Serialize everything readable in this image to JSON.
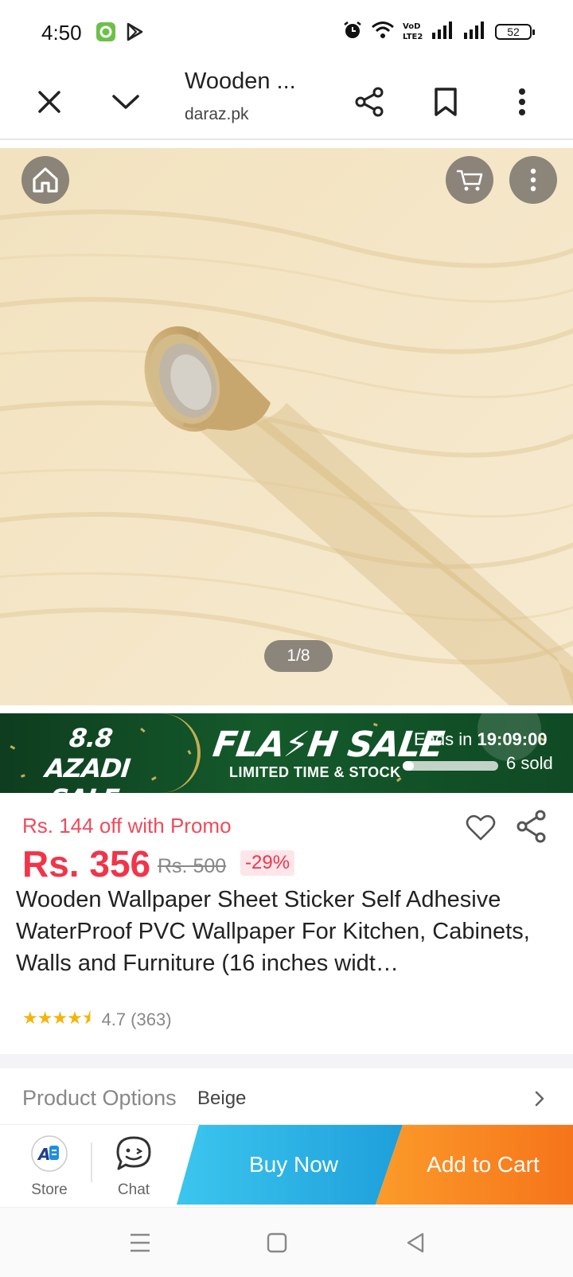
{
  "status_bar": {
    "time": "4:50",
    "battery": "52",
    "network_label": "VoLTE2"
  },
  "browser": {
    "page_title": "Wooden ...",
    "url": "daraz.pk"
  },
  "gallery": {
    "counter": "1/8",
    "current_index": 1,
    "total_images": 8
  },
  "flash_sale": {
    "campaign_line1": "8.8 AZADI",
    "campaign_line2": "SALE",
    "title": "FLA⚡H SALE",
    "subtitle": "LIMITED TIME & STOCK",
    "ends_label": "Ends in",
    "ends_time": "19:09:00",
    "sold": "6 sold",
    "progress_fraction": 0.06
  },
  "product": {
    "promo_text": "Rs. 144 off with Promo",
    "price": "Rs. 356",
    "original_price": "Rs. 500",
    "discount": "-29%",
    "title": "Wooden Wallpaper Sheet Sticker Self Adhesive WaterProof PVC Wallpaper For Kitchen, Cabinets, Walls and Furniture (16 inches widt…",
    "rating_value": "4.7",
    "rating_count": "(363)",
    "stars": "★★★★⯨"
  },
  "options": {
    "label": "Product Options",
    "value": "Beige"
  },
  "actions": {
    "store_label": "Store",
    "chat_label": "Chat",
    "buy_now": "Buy Now",
    "add_to_cart": "Add to Cart"
  },
  "colors": {
    "price_red": "#f0354b",
    "buy_now_blue": "#1e9fdb",
    "add_to_cart_orange": "#f6741a",
    "flash_green": "#145a2b"
  }
}
